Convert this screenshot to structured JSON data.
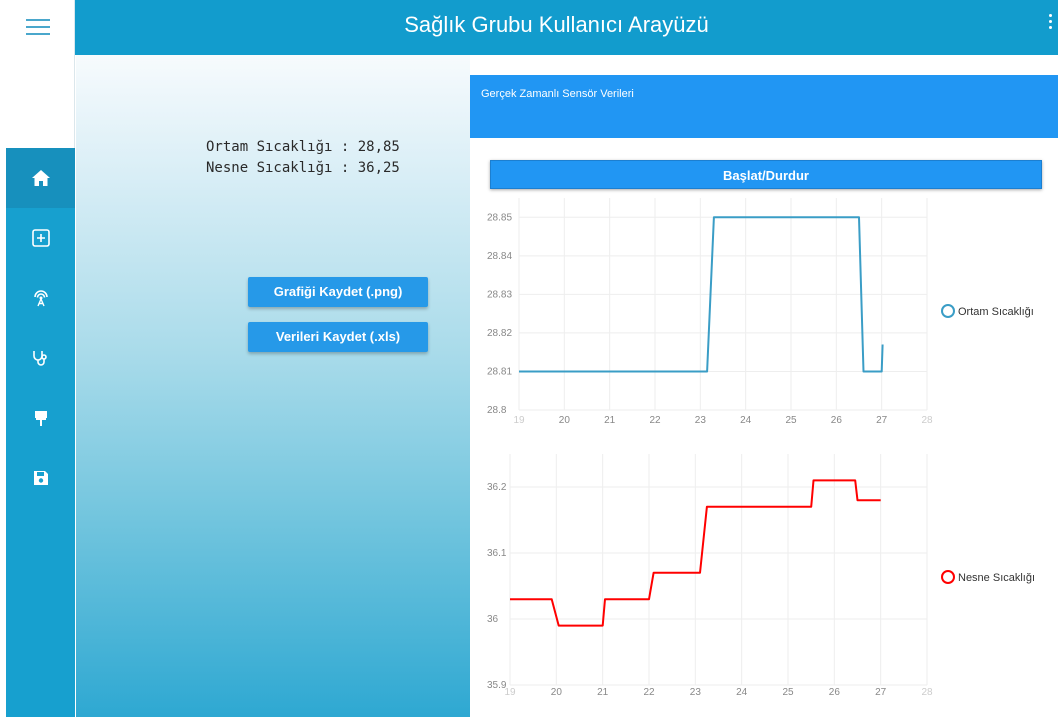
{
  "app": {
    "title": "Sağlık Grubu Kullanıcı Arayüzü"
  },
  "sidebar": {
    "items": [
      {
        "icon": "home-icon",
        "active": true
      },
      {
        "icon": "plus-box-icon"
      },
      {
        "icon": "antenna-icon"
      },
      {
        "icon": "stethoscope-icon"
      },
      {
        "icon": "pin-icon"
      },
      {
        "icon": "save-icon"
      }
    ]
  },
  "readings": {
    "ambient_label": "Ortam Sıcaklığı : 28,85",
    "object_label": "Nesne Sıcaklığı : 36,25"
  },
  "actions": {
    "save_chart": "Grafiği Kaydet (.png)",
    "save_data": "Verileri Kaydet (.xls)"
  },
  "panel": {
    "title": "Gerçek Zamanlı Sensör Verileri",
    "start_stop": "Başlat/Durdur"
  },
  "colors": {
    "accent": "#129ccd",
    "button": "#2196f3",
    "ambient_series": "#3a9dc6",
    "object_series": "#ff0000"
  },
  "chart_data": [
    {
      "type": "line",
      "xlim": [
        19,
        28
      ],
      "ylim": [
        28.8,
        28.855
      ],
      "x_ticks": [
        "19",
        "20",
        "21",
        "22",
        "23",
        "24",
        "25",
        "26",
        "27",
        "28"
      ],
      "y_ticks": [
        "28.8",
        "28.81",
        "28.82",
        "28.83",
        "28.84",
        "28.85"
      ],
      "grid": true,
      "legend_position": "right",
      "series": [
        {
          "name": "Ortam Sıcaklığı",
          "color": "#3a9dc6",
          "x": [
            19,
            23.15,
            23.3,
            26.5,
            26.6,
            27.0,
            27.02
          ],
          "y": [
            28.81,
            28.81,
            28.85,
            28.85,
            28.81,
            28.81,
            28.817
          ]
        }
      ]
    },
    {
      "type": "line",
      "xlim": [
        19,
        28
      ],
      "ylim": [
        35.9,
        36.25
      ],
      "x_ticks": [
        "19",
        "20",
        "21",
        "22",
        "23",
        "24",
        "25",
        "26",
        "27",
        "28"
      ],
      "y_ticks": [
        "35.9",
        "36",
        "36.1",
        "36.2"
      ],
      "grid": true,
      "legend_position": "right",
      "series": [
        {
          "name": "Nesne Sıcaklığı",
          "color": "#ff0000",
          "x": [
            19,
            19.9,
            20.05,
            21.0,
            21.05,
            22.0,
            22.1,
            23.1,
            23.25,
            25.5,
            25.55,
            26.45,
            26.5,
            27.0
          ],
          "y": [
            36.03,
            36.03,
            35.99,
            35.99,
            36.03,
            36.03,
            36.07,
            36.07,
            36.17,
            36.17,
            36.21,
            36.21,
            36.18,
            36.18
          ]
        }
      ]
    }
  ]
}
